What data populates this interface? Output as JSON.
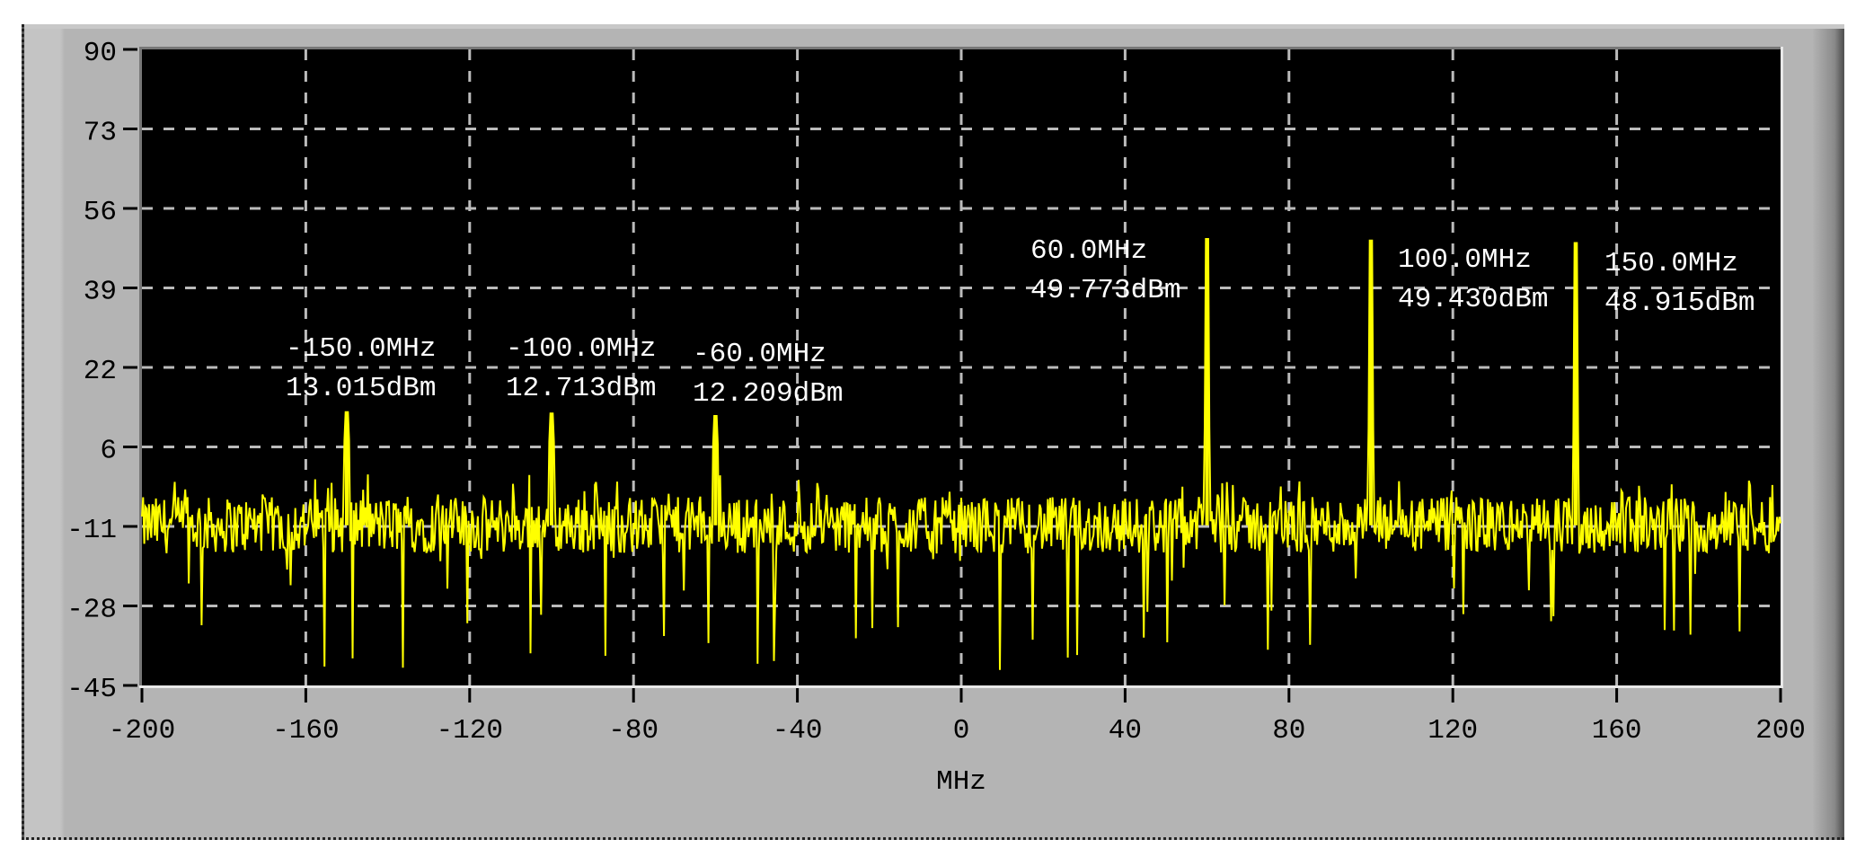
{
  "chart_data": {
    "type": "line",
    "title": "",
    "xlabel": "MHz",
    "ylabel": "",
    "xlim": [
      -200,
      200
    ],
    "ylim": [
      -45,
      90
    ],
    "xticks": [
      "-200",
      "-160",
      "-120",
      "-80",
      "-40",
      "0",
      "40",
      "80",
      "120",
      "160",
      "200"
    ],
    "xtick_values": [
      -200,
      -160,
      -120,
      -80,
      -40,
      0,
      40,
      80,
      120,
      160,
      200
    ],
    "yticks": [
      "90",
      "73",
      "56",
      "39",
      "22",
      "6",
      "-11",
      "-28",
      "-45"
    ],
    "ytick_values": [
      90,
      73.125,
      56.25,
      39.375,
      22.5,
      5.625,
      -11.25,
      -28.125,
      -45
    ],
    "grid": true,
    "series_color": "#ffff00",
    "plot_background": "#000000",
    "noise_floor": {
      "mean": -11,
      "spread": 6,
      "min_dips": -42
    },
    "peaks": [
      {
        "freq": -150,
        "level": 13.015,
        "freq_label": "-150.0MHz",
        "level_label": "13.015dBm"
      },
      {
        "freq": -100,
        "level": 12.713,
        "freq_label": "-100.0MHz",
        "level_label": "12.713dBm"
      },
      {
        "freq": -60,
        "level": 12.209,
        "freq_label": "-60.0MHz",
        "level_label": "12.209dBm"
      },
      {
        "freq": 60,
        "level": 49.773,
        "freq_label": "60.0MHz",
        "level_label": "49.773dBm"
      },
      {
        "freq": 100,
        "level": 49.43,
        "freq_label": "100.0MHz",
        "level_label": "49.430dBm"
      },
      {
        "freq": 150,
        "level": 48.915,
        "freq_label": "150.0MHz",
        "level_label": "48.915dBm"
      }
    ]
  }
}
